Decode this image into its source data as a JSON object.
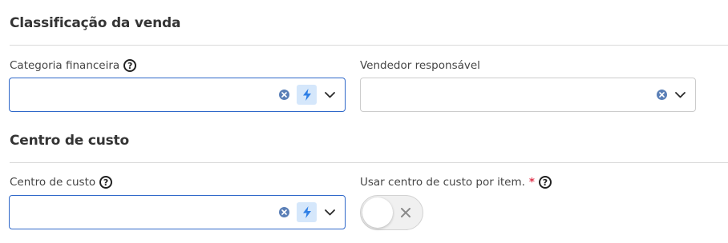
{
  "sections": {
    "sale_classification": {
      "title": "Classificação da venda",
      "financial_category": {
        "label": "Categoria financeira",
        "value": ""
      },
      "responsible_seller": {
        "label": "Vendedor responsável",
        "value": ""
      }
    },
    "cost_center": {
      "title": "Centro de custo",
      "cost_center_field": {
        "label": "Centro de custo",
        "value": ""
      },
      "use_per_item": {
        "label": "Usar centro de custo por item.",
        "required_mark": "*",
        "enabled": false
      }
    }
  },
  "icons": {
    "help": "question-circle",
    "clear": "x-circle",
    "quick_add": "lightning-bolt",
    "dropdown": "chevron-down",
    "toggle_off": "x"
  },
  "colors": {
    "focus_border": "#2f68c9",
    "bolt_background": "#d5e7fb",
    "bolt": "#2f7fe6",
    "required": "#e0374f"
  },
  "help_glyph": "?"
}
